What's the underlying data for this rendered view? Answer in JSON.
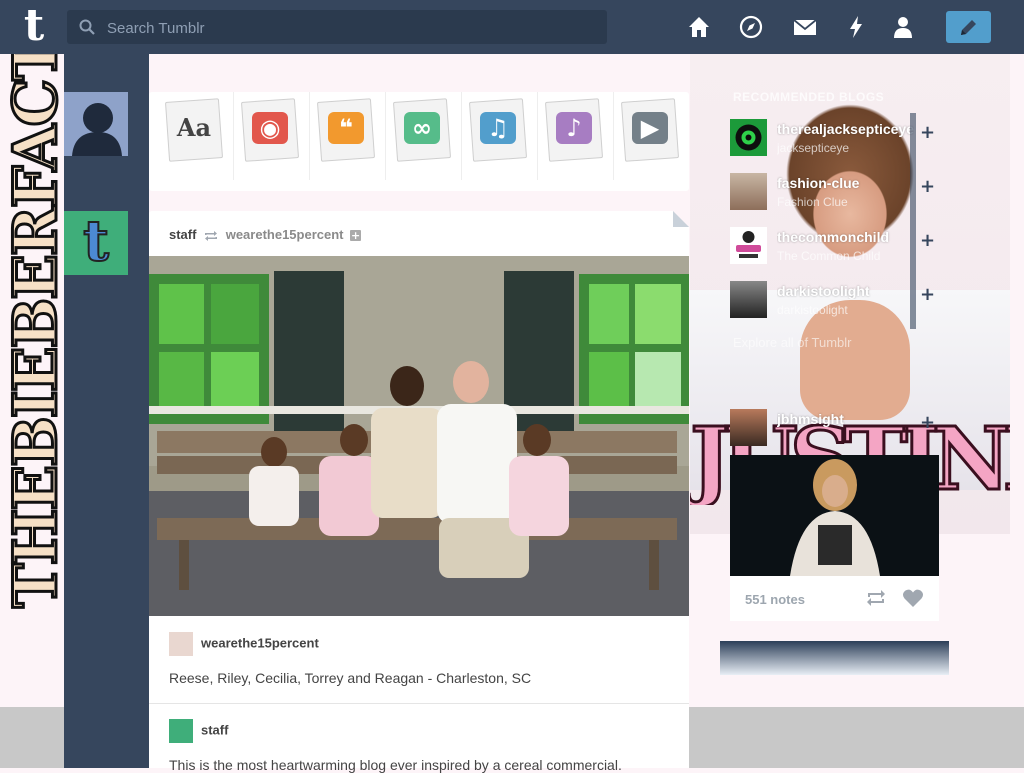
{
  "header": {
    "logo": "t",
    "search_placeholder": "Search Tumblr",
    "nav": [
      "home",
      "explore",
      "inbox",
      "activity",
      "account"
    ],
    "compose": "compose"
  },
  "background": {
    "vertical_text": "THEBIEBERFACTS",
    "sparkle_text": "JUSTINBIEBER"
  },
  "post_types": [
    {
      "glyph": "Aa",
      "color": "#444444",
      "bg": "transparent"
    },
    {
      "glyph": "◉",
      "color": "#ffffff",
      "bg": "#e2574c"
    },
    {
      "glyph": "❝",
      "color": "#ffffff",
      "bg": "#f2992e"
    },
    {
      "glyph": "∞",
      "color": "#ffffff",
      "bg": "#56bc8a"
    },
    {
      "glyph": "♫",
      "color": "#ffffff",
      "bg": "#529ecc"
    },
    {
      "glyph": "♪",
      "color": "#ffffff",
      "bg": "#a77dc2"
    },
    {
      "glyph": "▶",
      "color": "#ffffff",
      "bg": "#748089"
    }
  ],
  "post": {
    "author": "staff",
    "reblogged_from": "wearethe15percent",
    "attribution": "wearethe15percent",
    "caption": "Reese, Riley, Cecilia, Torrey and Reagan - Charleston, SC",
    "second_author": "staff",
    "second_text": "This is the most heartwarming blog ever inspired by a cereal commercial."
  },
  "sidebar": {
    "title": "Recommended Blogs",
    "blogs": [
      {
        "name": "therealjacksepticeye",
        "sub": "jacksepticeye",
        "color": "#1c9a3a"
      },
      {
        "name": "fashion-clue",
        "sub": "Fashion Clue",
        "color": "#b9a28e"
      },
      {
        "name": "thecommonchild",
        "sub": "The Common Child",
        "color": "#d04b9a"
      },
      {
        "name": "darkistoolight",
        "sub": "darkistoolight",
        "color": "#555555"
      }
    ],
    "explore_text": "Explore all of Tumblr",
    "radar_user": "jbhmsight",
    "radar_notes": "551 notes"
  }
}
